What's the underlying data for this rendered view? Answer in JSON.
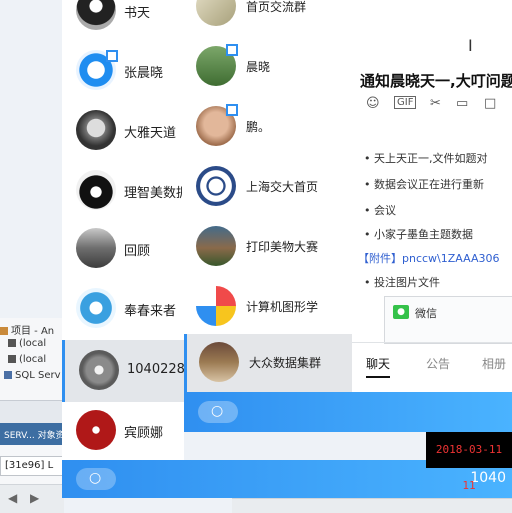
{
  "background_app": {
    "tree_items": [
      "项目 - An",
      "(local",
      "(local",
      "SQL Serv"
    ],
    "tab_header": "SERV... 对象资",
    "text_row": "[31e96] L"
  },
  "panel_a": {
    "contacts": [
      {
        "name": "书天"
      },
      {
        "name": "张晨晓"
      },
      {
        "name": "大雅天道"
      },
      {
        "name": "理智美数据"
      },
      {
        "name": "回顾"
      },
      {
        "name": "奉春来者"
      },
      {
        "name": "1040228"
      },
      {
        "name": "宾顾娜"
      }
    ],
    "footer_number": "1040"
  },
  "panel_b": {
    "conversations": [
      {
        "name": "首页交流群"
      },
      {
        "name": "晨晓"
      },
      {
        "name": "鹏。"
      },
      {
        "name": "上海交大首页"
      },
      {
        "name": "打印美物大赛"
      },
      {
        "name": "计算机图形学"
      },
      {
        "name": "大众数据集群"
      }
    ]
  },
  "chat": {
    "title": "通知晨晓天一,大叮问题",
    "messages": [
      "• 天上天正一,文件如题对",
      "• 数据会议正在进行重新",
      "• 会议",
      "• 小家子墨鱼主题数据",
      "【附件】pnccw\\1ZAAA306",
      "• 投注图片文件"
    ],
    "card_label": "微信",
    "tabs": [
      "聊天",
      "公告",
      "相册"
    ],
    "icons": [
      "emoji-icon",
      "gif-icon",
      "scissors-icon",
      "screen-icon",
      "window-icon"
    ]
  },
  "timestamp": "2018-03-11 11",
  "colors": {
    "accent": "#2f8ff0",
    "accent_light": "#4ab3ff"
  }
}
